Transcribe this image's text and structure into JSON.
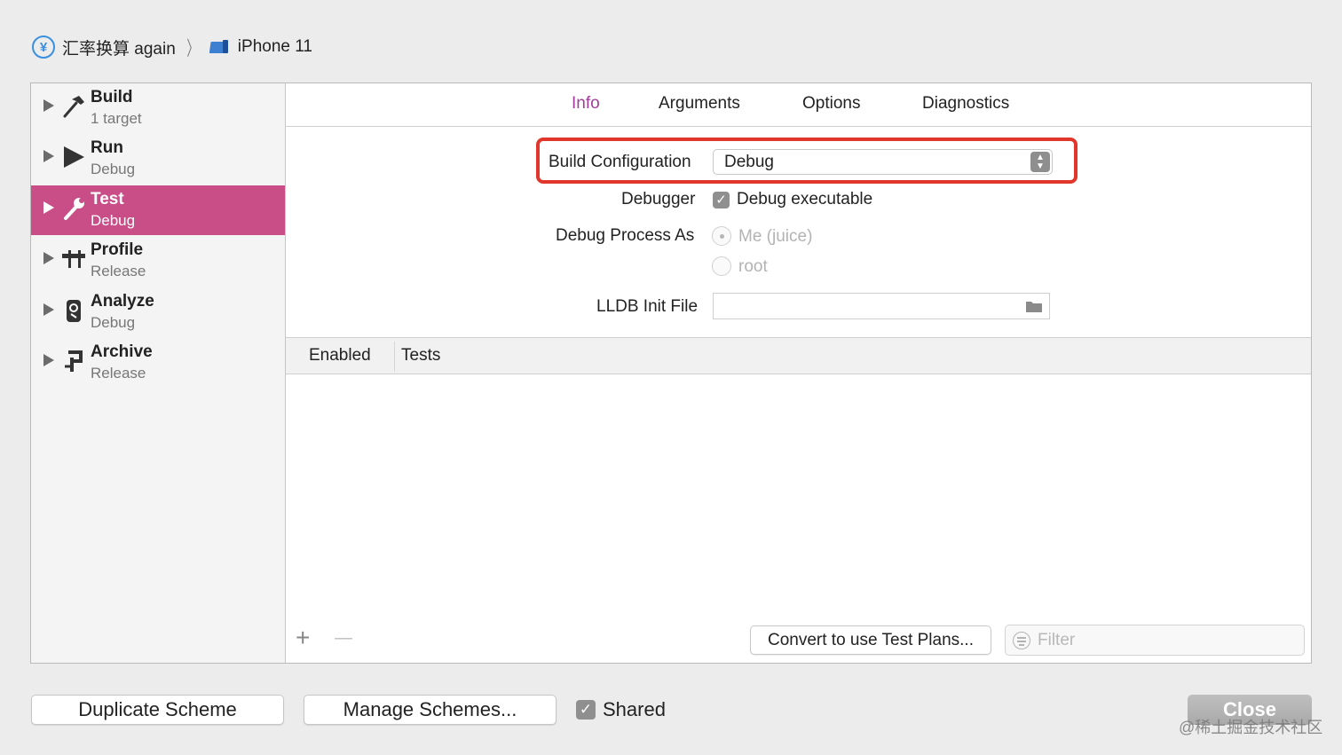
{
  "breadcrumb": {
    "app_icon_glyph": "¥",
    "app_name": "汇率换算 again",
    "separator": "〉",
    "device": "iPhone 11"
  },
  "sidebar": {
    "items": [
      {
        "title": "Build",
        "subtitle": "1 target",
        "icon": "hammer-icon"
      },
      {
        "title": "Run",
        "subtitle": "Debug",
        "icon": "play-icon"
      },
      {
        "title": "Test",
        "subtitle": "Debug",
        "icon": "wrench-icon",
        "selected": true
      },
      {
        "title": "Profile",
        "subtitle": "Release",
        "icon": "caliper-icon"
      },
      {
        "title": "Analyze",
        "subtitle": "Debug",
        "icon": "analyze-icon"
      },
      {
        "title": "Archive",
        "subtitle": "Release",
        "icon": "archive-icon"
      }
    ]
  },
  "tabs": [
    {
      "label": "Info",
      "active": true
    },
    {
      "label": "Arguments"
    },
    {
      "label": "Options"
    },
    {
      "label": "Diagnostics"
    }
  ],
  "form": {
    "build_configuration_label": "Build Configuration",
    "build_configuration_value": "Debug",
    "debugger_label": "Debugger",
    "debugger_checkbox_label": "Debug executable",
    "debug_process_label": "Debug Process As",
    "radio_me": "Me (juice)",
    "radio_root": "root",
    "lldb_label": "LLDB Init File",
    "lldb_value": ""
  },
  "table": {
    "columns": [
      "Enabled",
      "Tests"
    ]
  },
  "footer_controls": {
    "plus": "+",
    "minus": "—",
    "convert_button": "Convert to use Test Plans...",
    "filter_placeholder": "Filter"
  },
  "bottom": {
    "duplicate_button": "Duplicate Scheme",
    "manage_button": "Manage Schemes...",
    "shared_label": "Shared",
    "close_button": "Close",
    "watermark": "@稀土掘金技术社区"
  },
  "colors": {
    "selection": "#c94d86",
    "active_tab": "#a33c9c",
    "highlight": "#e0362b"
  }
}
